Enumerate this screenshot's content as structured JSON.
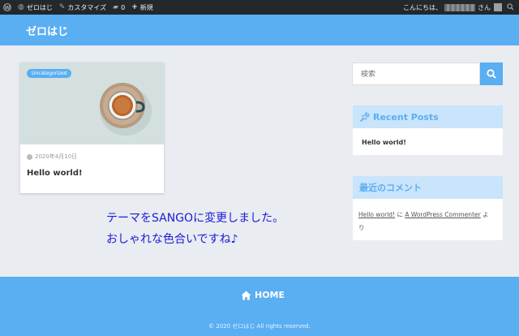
{
  "adminbar": {
    "site_name": "ゼロはじ",
    "customize": "カスタマイズ",
    "comments_count": "0",
    "new_label": "新規",
    "greeting": "こんにちは、",
    "honorific": "さん"
  },
  "header": {
    "site_title": "ゼロはじ"
  },
  "post_card": {
    "category": "Uncategorized",
    "date": "2020年4月10日",
    "title": "Hello world!"
  },
  "note": {
    "line1": "テーマをSANGOに変更しました。",
    "line2": "おしゃれな色合いですね♪"
  },
  "sidebar": {
    "search_placeholder": "検索",
    "recent_posts": {
      "title": "Recent Posts",
      "items": [
        "Hello world!"
      ]
    },
    "recent_comments": {
      "title": "最近のコメント",
      "post_link": "Hello world!",
      "connector": "に",
      "author_link": "A WordPress Commenter",
      "suffix_1": "よ",
      "suffix_2": "り"
    }
  },
  "footer": {
    "home_label": "HOME",
    "copyright": "© 2020 ゼロはじ All rights reserved."
  },
  "colors": {
    "accent": "#5aaef2",
    "adminbar": "#23282d",
    "widget_head": "#c9e4fb",
    "note_text": "#1a1ad8"
  }
}
